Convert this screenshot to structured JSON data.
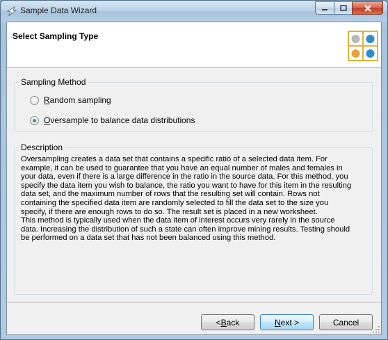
{
  "window": {
    "title": "Sample Data Wizard"
  },
  "header": {
    "title": "Select Sampling Type"
  },
  "sampling_method": {
    "legend": "Sampling Method",
    "options": [
      {
        "accel": "R",
        "rest": "andom sampling",
        "selected": false
      },
      {
        "accel": "O",
        "rest": "versample to balance data distributions",
        "selected": true
      }
    ]
  },
  "description": {
    "legend": "Description",
    "text": "Oversampling creates a data set that contains a specific ratio of a selected data item. For\nexample, it can be used to guarantee that you have an equal number of males and females in\nyour data, even if there is a large difference in the ratio in the source data. For this method, you\nspecify the data item you wish to balance, the ratio you want to have for this item in the resulting\ndata set, and the maximum number of rows that the resulting set will contain. Rows not\ncontaining the specified data item are randomly selected to fill the data set to the size you\nspecify, if there are enough rows to do so. The result set is placed in a new worksheet.\nThis method is typically used when the data item of interest occurs very rarely in the source\ndata. Increasing the distribution of such a state can often improve mining results. Testing should\nbe performed on a data set that has not been balanced using this method."
  },
  "buttons": {
    "back": {
      "prefix": "< ",
      "accel": "B",
      "rest": "ack"
    },
    "next": {
      "accel": "N",
      "rest": "ext >"
    },
    "cancel": {
      "label": "Cancel"
    }
  },
  "icons": {
    "app": "wizard-app-icon",
    "header": "data-dots-icon",
    "minimize": "minimize-icon",
    "maximize": "maximize-icon",
    "close": "close-icon"
  },
  "colors": {
    "close_button": "#c63d24",
    "radio_selected": "#1d4e9e",
    "default_button_border": "#3c7fb1"
  }
}
